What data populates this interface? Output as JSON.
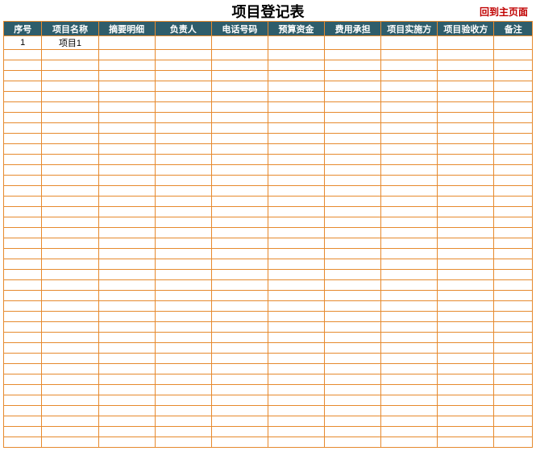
{
  "title": "项目登记表",
  "back_link": "回到主页面",
  "chart_data": {
    "type": "table",
    "columns": [
      "序号",
      "项目名称",
      "摘要明细",
      "负责人",
      "电话号码",
      "预算资金",
      "费用承担",
      "项目实施方",
      "项目验收方",
      "备注"
    ],
    "rows": [
      [
        "1",
        "项目1",
        "",
        "",
        "",
        "",
        "",
        "",
        "",
        ""
      ]
    ],
    "empty_row_count": 38
  },
  "colors": {
    "header_bg": "#2e5d6b",
    "header_fg": "#ffffff",
    "grid_border": "#e68a2e",
    "link_color": "#c00000"
  }
}
